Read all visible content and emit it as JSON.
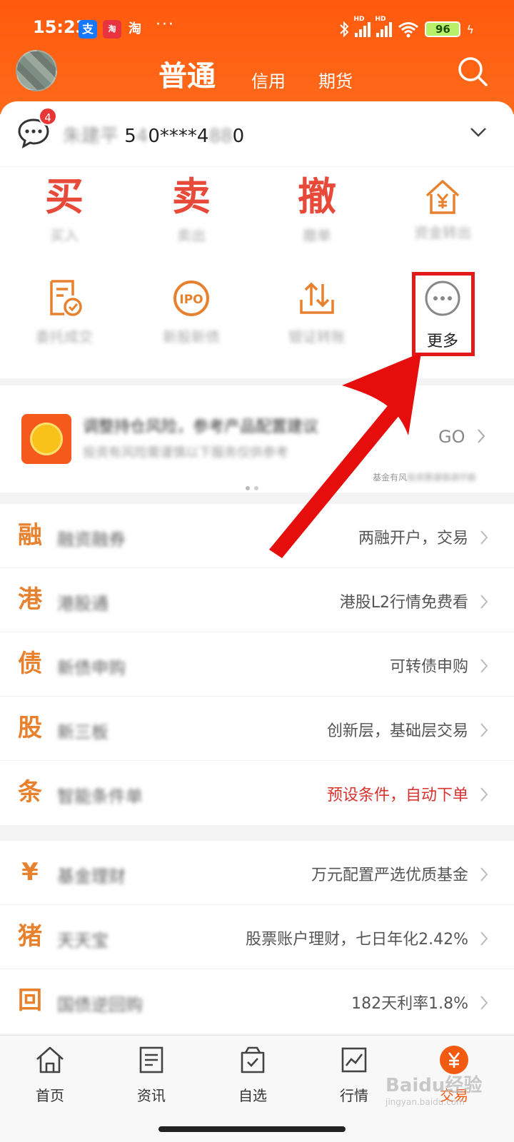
{
  "status_bar": {
    "time": "15:23",
    "apps": [
      "支",
      "淘",
      "淘"
    ],
    "more": "···",
    "battery": "96"
  },
  "header": {
    "tab_active": "普通",
    "tab_credit": "信用",
    "tab_futures": "期货"
  },
  "account": {
    "badge": "4",
    "name": "朱建平",
    "id_prefix": "5",
    "id_mid": "0****4",
    "id_suffix": "0"
  },
  "actions": {
    "buy": {
      "char": "买",
      "sub": "买入"
    },
    "sell": {
      "char": "卖",
      "sub": "卖出"
    },
    "cancel": {
      "char": "撤",
      "sub": "撤单"
    },
    "bank": {
      "sub": "资金转出"
    },
    "orders": {
      "label": "委托成交"
    },
    "ipo": {
      "label": "新股新债"
    },
    "transfer": {
      "label": "银证转账"
    },
    "more": {
      "label": "更多"
    }
  },
  "banner": {
    "line1": "调整持仓风险，参考产品配置建议",
    "line2": "投资有风险需谨慎以下服务仅供参考",
    "go": "GO",
    "note": "基金有风"
  },
  "list1": [
    {
      "icon": "融",
      "title": "融资融券",
      "right": "两融开户，交易",
      "red": false
    },
    {
      "icon": "港",
      "title": "港股通",
      "right": "港股L2行情免费看",
      "red": false
    },
    {
      "icon": "债",
      "title": "新债申购",
      "right": "可转债申购",
      "red": false
    },
    {
      "icon": "股",
      "title": "新三板",
      "right": "创新层，基础层交易",
      "red": false
    },
    {
      "icon": "条",
      "title": "智能条件单",
      "right": "预设条件，自动下单",
      "red": true
    }
  ],
  "list2": [
    {
      "icon": "¥",
      "title": "基金理财",
      "right": "万元配置严选优质基金",
      "red": false
    },
    {
      "icon": "猪",
      "title": "天天宝",
      "right": "股票账户理财，七日年化2.42%",
      "red": false
    },
    {
      "icon": "回",
      "title": "国债逆回购",
      "right": "182天利率1.8%",
      "red": false
    }
  ],
  "bottom_nav": [
    {
      "label": "首页"
    },
    {
      "label": "资讯"
    },
    {
      "label": "自选"
    },
    {
      "label": "行情"
    },
    {
      "label": "交易",
      "active": true
    }
  ],
  "watermark": "Baidu经验",
  "watermark_sub": "jingyan.baidu.com"
}
